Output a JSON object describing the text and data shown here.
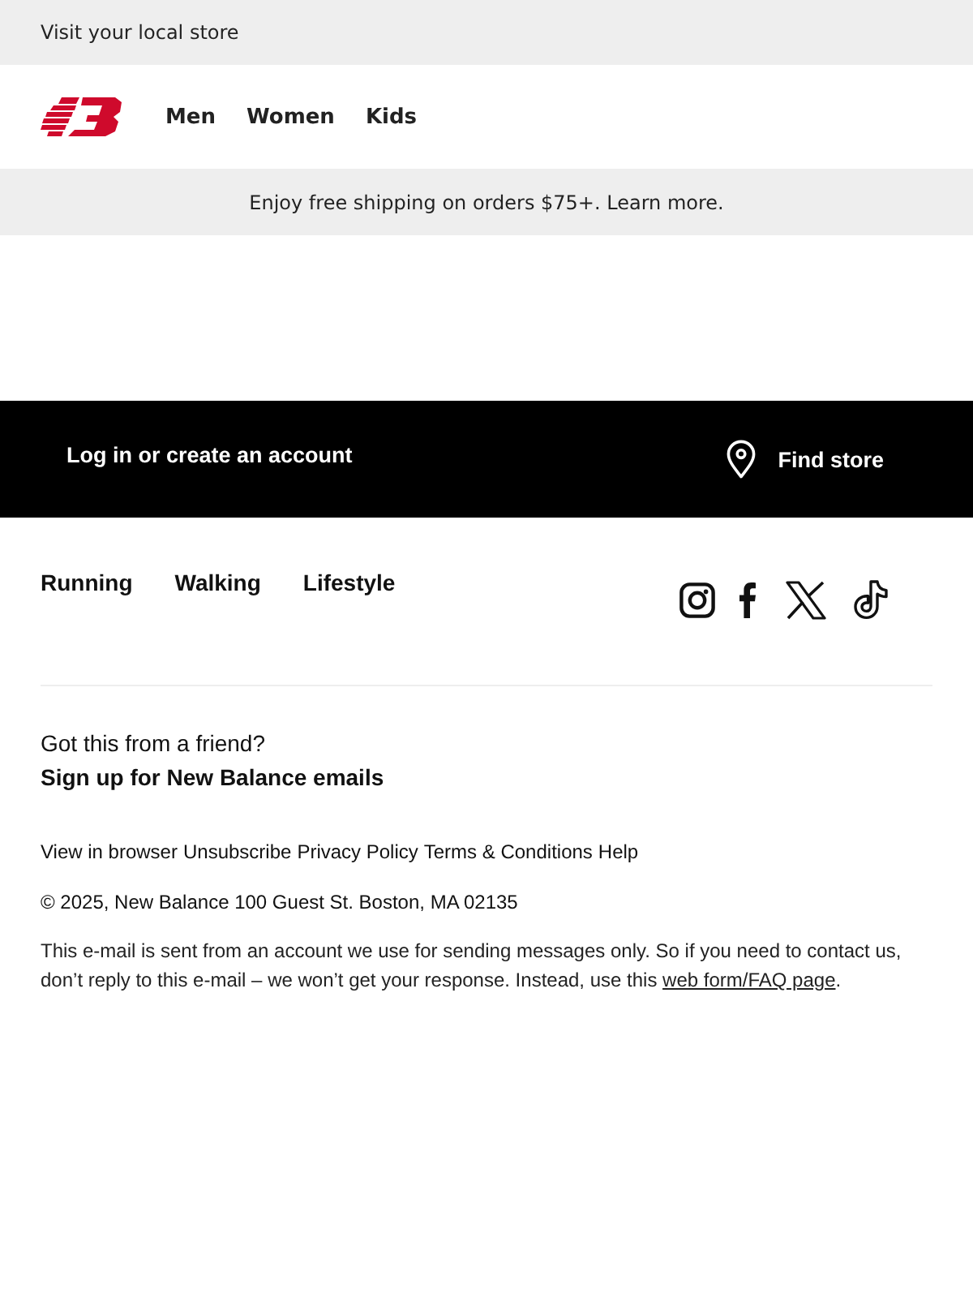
{
  "top_bar": {
    "text": "Visit your local store"
  },
  "header": {
    "nav": [
      {
        "label": "Men"
      },
      {
        "label": "Women"
      },
      {
        "label": "Kids"
      }
    ]
  },
  "promo_banner": {
    "text": "Enjoy free shipping on orders $75+. Learn more."
  },
  "account_bar": {
    "login": "Log in or create an account",
    "find_store": "Find store"
  },
  "footer": {
    "categories": [
      {
        "label": "Running"
      },
      {
        "label": "Walking"
      },
      {
        "label": "Lifestyle"
      }
    ],
    "referral": {
      "question": "Got this from a friend?",
      "signup": "Sign up for New Balance emails"
    },
    "links": [
      {
        "label": "View in browser"
      },
      {
        "label": "Unsubscribe"
      },
      {
        "label": "Privacy Policy"
      },
      {
        "label": "Terms & Conditions"
      },
      {
        "label": "Help"
      }
    ],
    "copyright": "© 2025, New Balance 100 Guest St. Boston, MA 02135",
    "disclaimer": {
      "text": "This e-mail is sent from an account we use for sending messages only. So if you need to contact us, don’t reply to this e-mail – we won’t get your response. Instead, use this ",
      "link": "web form/FAQ page",
      "end": "."
    }
  }
}
